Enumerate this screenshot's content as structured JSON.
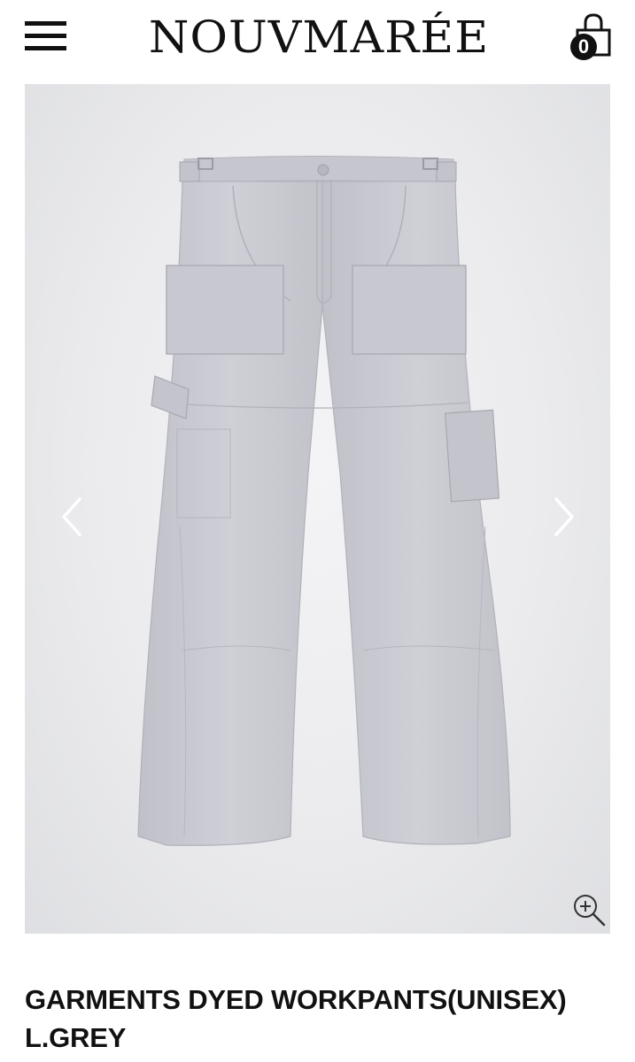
{
  "header": {
    "brand": "NOUVMARÉE",
    "cart_count": "0",
    "menu_icon": "hamburger-icon",
    "cart_icon": "shopping-bag-icon"
  },
  "gallery": {
    "product_image": "grey-cargo-work-pants",
    "prev_icon": "chevron-left-icon",
    "next_icon": "chevron-right-icon",
    "zoom_icon": "zoom-in-icon"
  },
  "product": {
    "title_line1": "GARMENTS DYED WORKPANTS(UNISEX)",
    "title_line2": "L.GREY"
  },
  "colors": {
    "text": "#111111",
    "image_bg": "#ebebed",
    "pants": "#c9cad1"
  }
}
